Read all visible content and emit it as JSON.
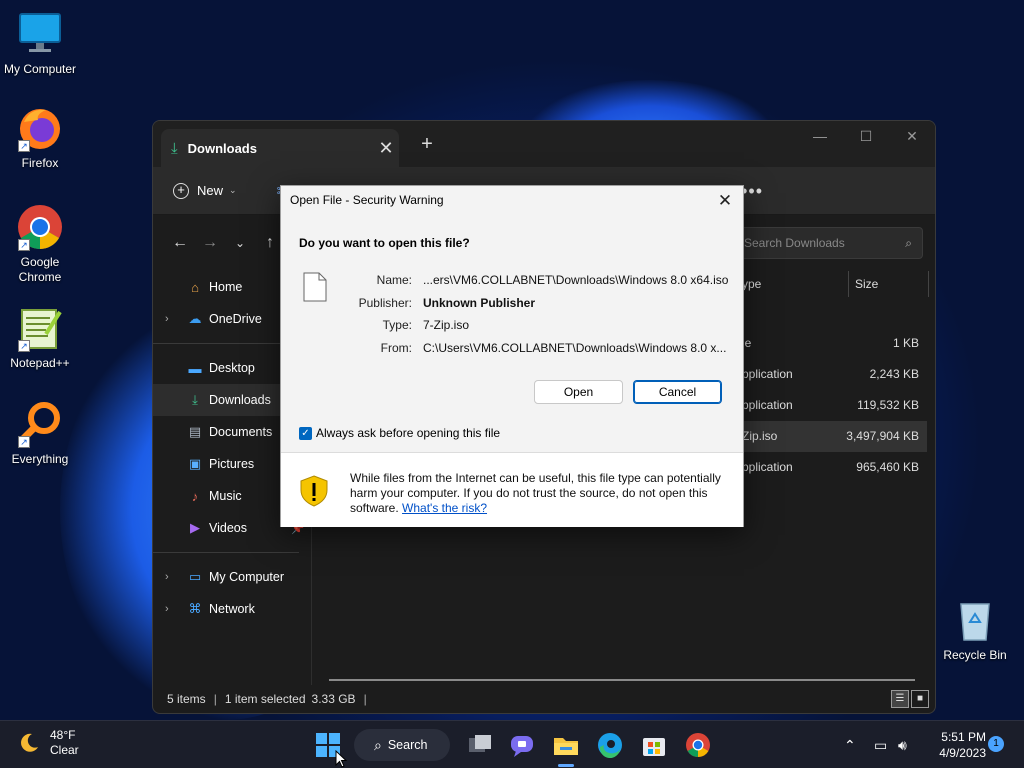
{
  "desktop": {
    "icons": [
      {
        "label": "My Computer"
      },
      {
        "label": "Firefox"
      },
      {
        "label": "Google Chrome"
      },
      {
        "label": "Notepad++"
      },
      {
        "label": "Everything"
      },
      {
        "label": "Recycle Bin"
      }
    ]
  },
  "explorer": {
    "tab_title": "Downloads",
    "new_label": "New",
    "search_placeholder": "Search Downloads",
    "sidebar": [
      {
        "label": "Home"
      },
      {
        "label": "OneDrive"
      },
      {
        "label": "Desktop"
      },
      {
        "label": "Downloads"
      },
      {
        "label": "Documents"
      },
      {
        "label": "Pictures"
      },
      {
        "label": "Music"
      },
      {
        "label": "Videos"
      },
      {
        "label": "My Computer"
      },
      {
        "label": "Network"
      }
    ],
    "columns": {
      "type": "ype",
      "size": "Size"
    },
    "files": [
      {
        "type": "le",
        "size": "1 KB"
      },
      {
        "type": "pplication",
        "size": "2,243 KB"
      },
      {
        "type": "pplication",
        "size": "119,532 KB"
      },
      {
        "type": "Zip.iso",
        "size": "3,497,904 KB"
      },
      {
        "type": "pplication",
        "size": "965,460 KB"
      }
    ],
    "status": {
      "items": "5 items",
      "selected": "1 item selected",
      "size": "3.33 GB"
    }
  },
  "dialog": {
    "title": "Open File - Security Warning",
    "question": "Do you want to open this file?",
    "name_label": "Name:",
    "name_value": "...ers\\VM6.COLLABNET\\Downloads\\Windows 8.0 x64.iso",
    "publisher_label": "Publisher:",
    "publisher_value": "Unknown Publisher",
    "type_label": "Type:",
    "type_value": "7-Zip.iso",
    "from_label": "From:",
    "from_value": "C:\\Users\\VM6.COLLABNET\\Downloads\\Windows 8.0 x...",
    "open_label": "Open",
    "cancel_label": "Cancel",
    "checkbox_label": "Always ask before opening this file",
    "warning_text": "While files from the Internet can be useful, this file type can potentially harm your computer. If you do not trust the source, do not open this software.",
    "risk_link": "What's the risk?"
  },
  "taskbar": {
    "temperature": "48°F",
    "condition": "Clear",
    "search_label": "Search",
    "time": "5:51 PM",
    "date": "4/9/2023",
    "notification_count": "1"
  },
  "colors": {
    "accent": "#0067c0",
    "link": "#0050c8",
    "shield": "#f5c400"
  }
}
